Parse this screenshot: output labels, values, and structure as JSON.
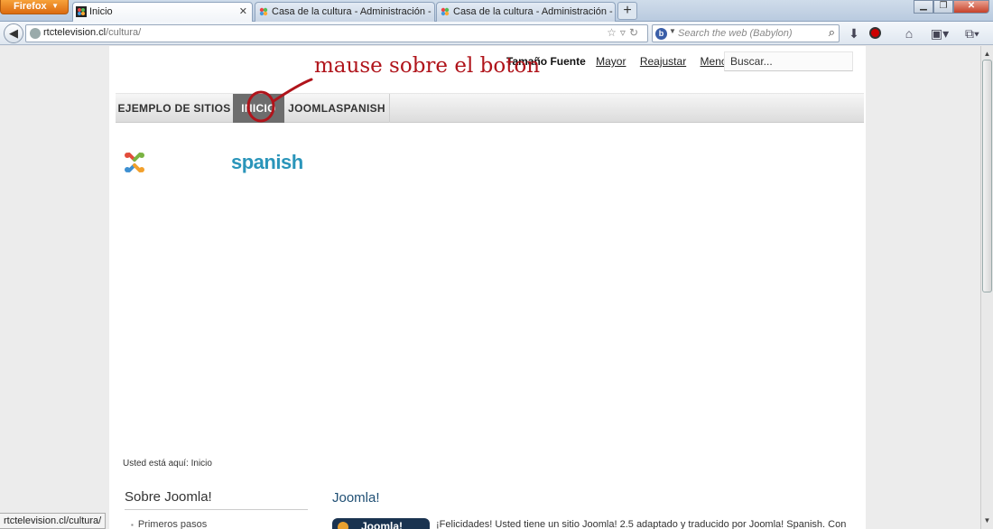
{
  "browser": {
    "app_button": "Firefox",
    "tabs": [
      {
        "title": "Inicio",
        "active": true
      },
      {
        "title": "Casa de la cultura - Administración - Ge...",
        "active": false
      },
      {
        "title": "Casa de la cultura - Administración - Ge...",
        "active": false
      }
    ],
    "new_tab": "+",
    "url_host": "rtctelevision.cl",
    "url_path": "/cultura/",
    "search_placeholder": "Search the web (Babylon)",
    "search_engine_icon": "babylon-icon",
    "status_text": "rtctelevision.cl/cultura/"
  },
  "page": {
    "font_size": {
      "label": "Tamaño Fuente",
      "bigger": "Mayor",
      "reset": "Reajustar",
      "smaller": "Menor"
    },
    "search": {
      "value": "Buscar..."
    },
    "menu": [
      {
        "label": "EJEMPLO DE SITIOS",
        "active": false
      },
      {
        "label": "INICIO",
        "active": true
      },
      {
        "label": "JOOMLASPANISH",
        "active": false
      }
    ],
    "logo_text": "spanish",
    "breadcrumbs": "Usted está aquí: Inicio",
    "sidebar_module": {
      "title": "Sobre Joomla!",
      "items": [
        "Primeros pasos"
      ]
    },
    "article": {
      "title": "Joomla!",
      "image_text": "Joomla!",
      "text": "¡Felicidades! Usted tiene un sitio Joomla! 2.5 adaptado y traducido por Joomla! Spanish. Con"
    }
  },
  "annotation": {
    "text": "mause sobre el boton",
    "color": "#b0141b"
  },
  "colors": {
    "menu_active_bg": "#6d6d6d",
    "logo_blue": "#2a95ba",
    "firefox_orange": "#e07a1c"
  }
}
